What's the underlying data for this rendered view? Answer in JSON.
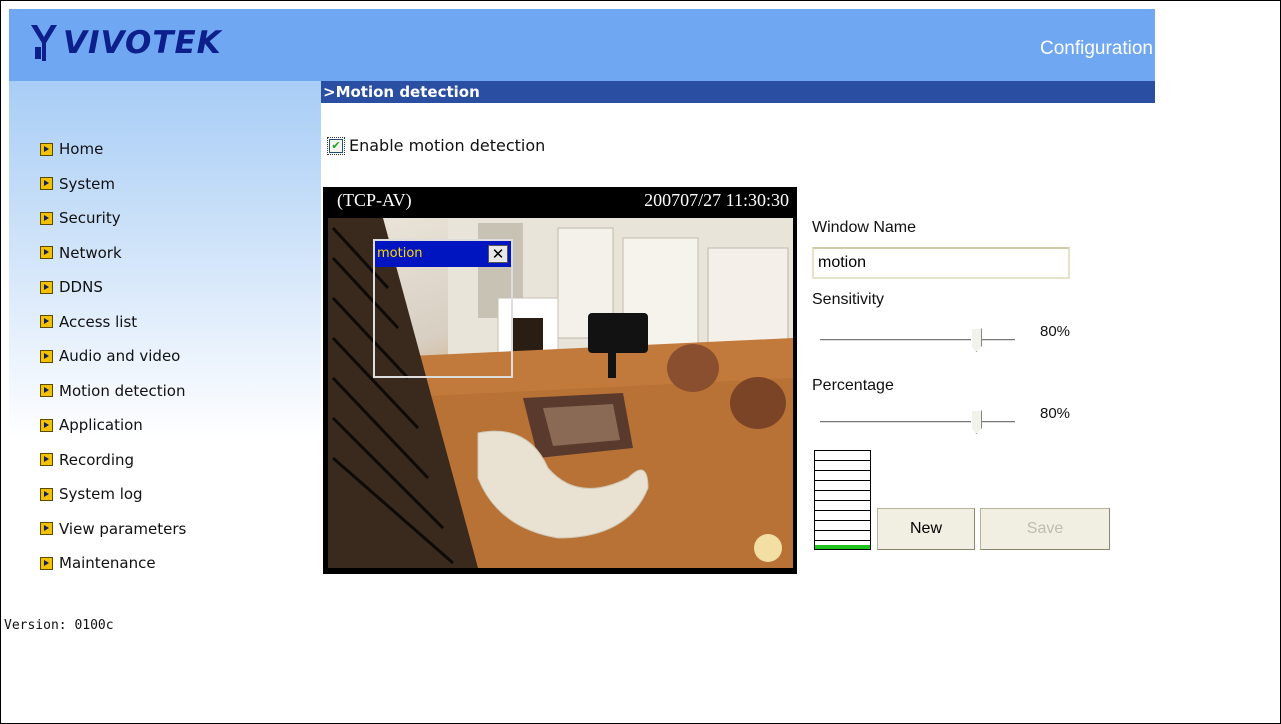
{
  "header": {
    "logo_text": "VIVOTEK",
    "title": "Configuration"
  },
  "sidebar": {
    "items": [
      {
        "label": "Home"
      },
      {
        "label": "System"
      },
      {
        "label": "Security"
      },
      {
        "label": "Network"
      },
      {
        "label": "DDNS"
      },
      {
        "label": "Access list"
      },
      {
        "label": "Audio and video"
      },
      {
        "label": "Motion detection"
      },
      {
        "label": "Application"
      },
      {
        "label": "Recording"
      },
      {
        "label": "System log"
      },
      {
        "label": "View parameters"
      },
      {
        "label": "Maintenance"
      }
    ],
    "version": "Version: 0100c"
  },
  "main": {
    "section_title": ">Motion detection",
    "enable_label": "Enable motion detection",
    "enable_checked": true,
    "video": {
      "source": "(TCP-AV)",
      "timestamp": "200707/27  11:30:30",
      "motion_window_title": "motion",
      "close_glyph": "✕"
    },
    "window_name_label": "Window Name",
    "window_name_value": "motion",
    "sensitivity_label": "Sensitivity",
    "sensitivity_value": "80%",
    "sensitivity_level": 0.8,
    "percentage_label": "Percentage",
    "percentage_value": "80%",
    "percentage_level": 0.8,
    "new_button": "New",
    "save_button": "Save"
  },
  "colors": {
    "header_bg": "#6fa7f2",
    "section_bar": "#2a4ea1",
    "motion_titlebar": "#0015c0",
    "meter_level": "#1cc41c"
  }
}
